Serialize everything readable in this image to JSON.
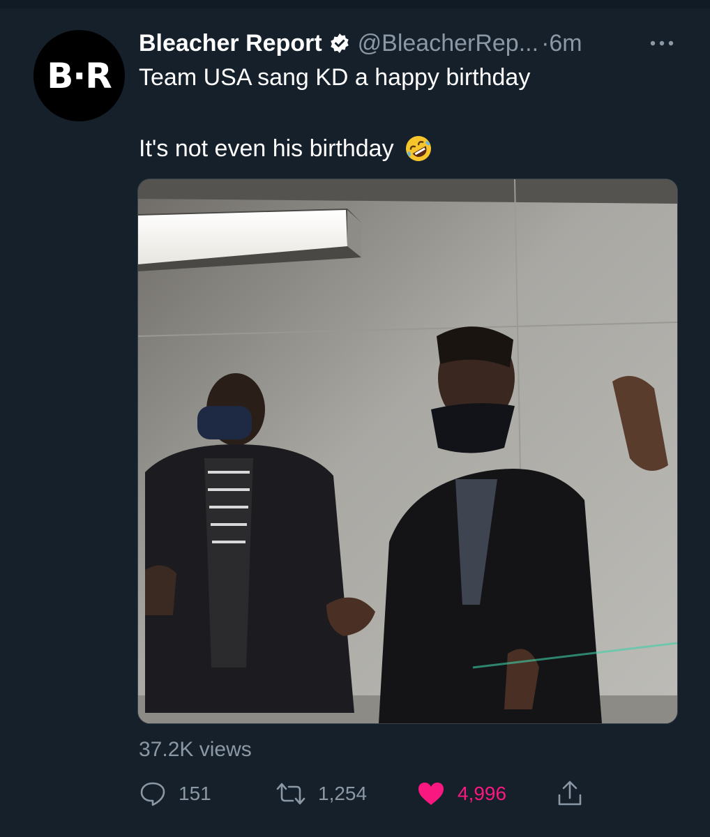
{
  "avatar": {
    "text": "B·R"
  },
  "tweet": {
    "display_name": "Bleacher Report",
    "handle": "@BleacherRep...",
    "separator": "·",
    "time": "6m",
    "line1": "Team USA sang KD a happy birthday",
    "line2": "It's not even his birthday",
    "emoji": "rolling-on-the-floor-laughing-emoji"
  },
  "stats": {
    "views": "37.2K views",
    "replies": "151",
    "retweets": "1,254",
    "likes": "4,996"
  },
  "colors": {
    "background": "#15202b",
    "secondary_text": "#8b98a5",
    "like": "#f91880"
  },
  "icons": {
    "verified": "verified-badge-icon",
    "more": "more-icon",
    "reply": "reply-icon",
    "retweet": "retweet-icon",
    "like": "heart-icon",
    "share": "share-icon"
  }
}
